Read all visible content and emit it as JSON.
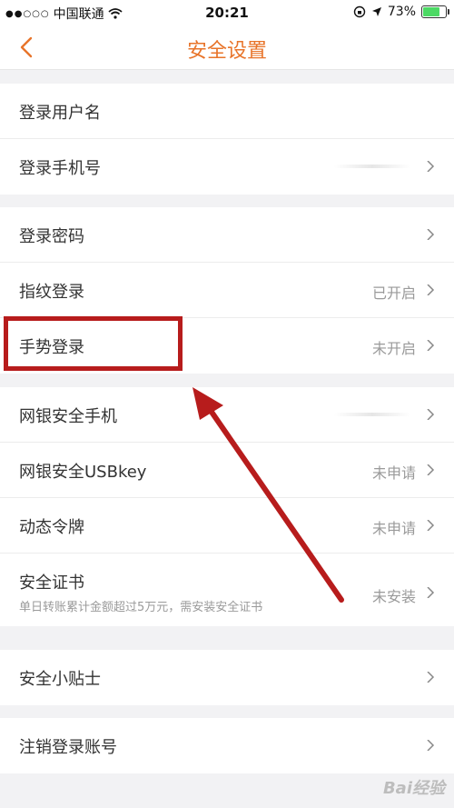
{
  "status": {
    "carrier": "中国联通",
    "time": "20:21",
    "battery": "73%",
    "battery_level": 0.73
  },
  "nav": {
    "title": "安全设置"
  },
  "groups": [
    {
      "rows": [
        {
          "label": "登录用户名"
        },
        {
          "label": "登录手机号"
        }
      ]
    },
    {
      "rows": [
        {
          "label": "登录密码"
        },
        {
          "label": "指纹登录",
          "value": "已开启"
        },
        {
          "label": "手势登录",
          "value": "未开启"
        }
      ]
    },
    {
      "rows": [
        {
          "label": "网银安全手机"
        },
        {
          "label": "网银安全USBkey",
          "value": "未申请"
        },
        {
          "label": "动态令牌",
          "value": "未申请"
        },
        {
          "label": "安全证书",
          "sub": "单日转账累计金额超过5万元，需安装安全证书",
          "value": "未安装"
        }
      ]
    },
    {
      "rows": [
        {
          "label": "安全小贴士"
        }
      ]
    },
    {
      "rows": [
        {
          "label": "注销登录账号"
        }
      ]
    }
  ],
  "watermark": "Bai经验",
  "colors": {
    "accent": "#e8742a",
    "annotation": "#b71c1c",
    "background": "#f2f2f4"
  }
}
